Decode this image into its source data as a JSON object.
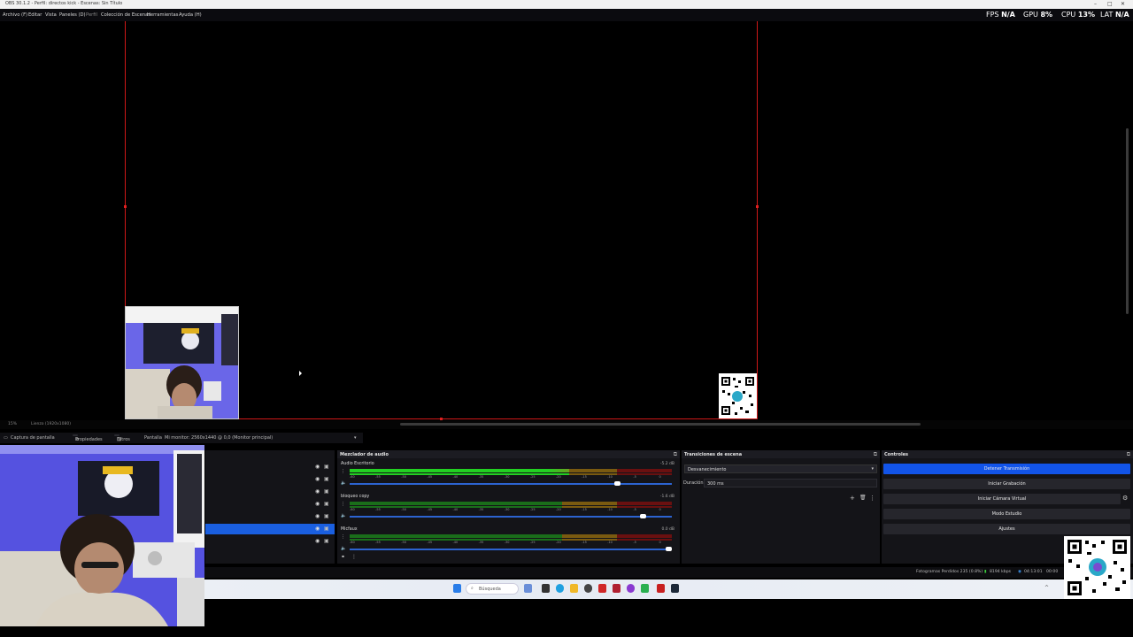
{
  "window": {
    "title": "OBS 30.1.2 - Perfil: directos kick - Escenas: Sin Título"
  },
  "menu": {
    "items": [
      "Archivo (F)",
      "Editar",
      "Vista",
      "Paneles (D)",
      "Perfil",
      "Colección de Escenas",
      "Herramientas",
      "Ayuda (H)"
    ]
  },
  "stats": {
    "fps_label": "FPS",
    "fps_value": "N/A",
    "gpu_label": "GPU",
    "gpu_value": "8%",
    "cpu_label": "CPU",
    "cpu_value": "13%",
    "lat_label": "LAT",
    "lat_value": "N/A"
  },
  "zoom": {
    "level": "15%",
    "fit": "Lienzo (1920x1080)"
  },
  "source_toolbar": {
    "source_name": "Captura de pantalla",
    "properties": "Propiedades",
    "filters": "Filtros",
    "display_label": "Pantalla",
    "display_value": "Mi monitor: 2560x1440 @ 0,0 (Monitor principal)"
  },
  "mixer": {
    "title": "Mezclador de audio",
    "channels": [
      {
        "name": "Audio Escritorio",
        "db": "-5.2 dB",
        "level": 0.68,
        "fader": 0.84
      },
      {
        "name": "bloqueo copy",
        "db": "-1.6 dB",
        "level": 0,
        "fader": 0.92
      },
      {
        "name": "Micfaux",
        "db": "0.0 dB",
        "level": 0,
        "fader": 1.0
      }
    ],
    "ticks": [
      "-60",
      "-55",
      "-50",
      "-45",
      "-40",
      "-35",
      "-30",
      "-25",
      "-20",
      "-15",
      "-10",
      "-5",
      "0"
    ]
  },
  "transitions": {
    "title": "Transiciones de escena",
    "selected": "Desvanecimiento",
    "duration_label": "Duración",
    "duration_value": "300 ms"
  },
  "controls": {
    "title": "Controles",
    "buttons": [
      "Detener Transmisión",
      "Iniciar Grabación",
      "Iniciar Cámara Virtual",
      "Modo Estudio",
      "Ajustes"
    ]
  },
  "statusbar": {
    "dropped": "Fotogramas Perdidos 235 (0.8%)",
    "bitrate": "8194 kbps",
    "time": "04:13:01",
    "rec": "00:00"
  },
  "taskbar": {
    "search_placeholder": "Búsqueda"
  },
  "colors": {
    "accent_blue": "#1254e8",
    "selection_red": "#d01818",
    "meter_green": "#22d022",
    "meter_orange": "#7a5a10",
    "meter_red": "#6a1010"
  }
}
